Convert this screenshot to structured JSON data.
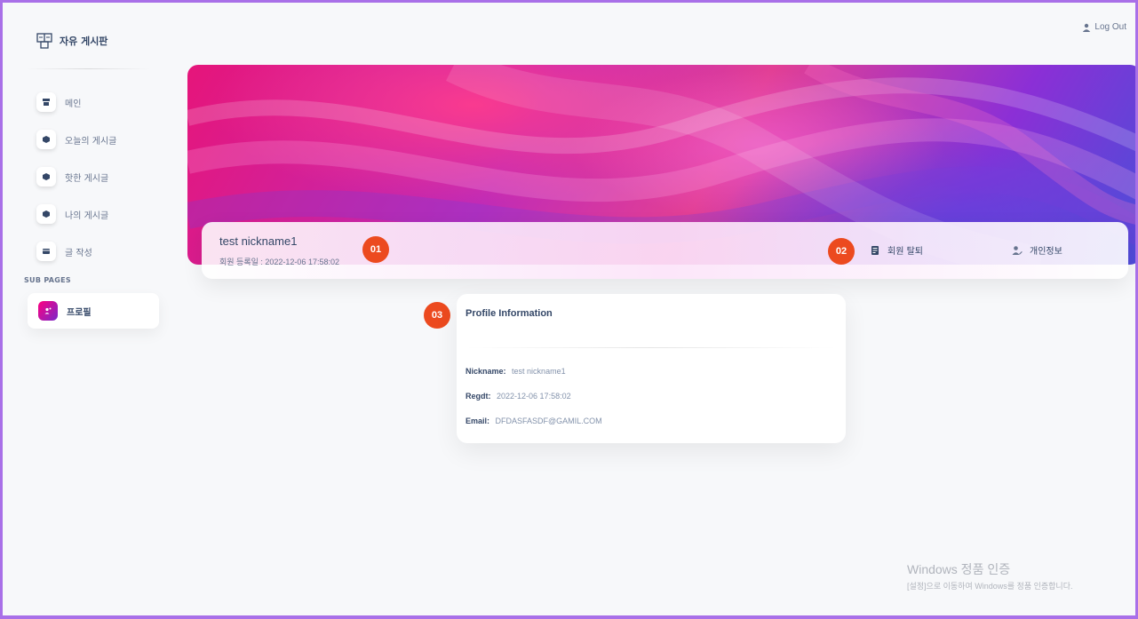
{
  "brand": {
    "title": "자유 게시판",
    "icon": "board-logo-icon"
  },
  "sidebar": {
    "items": [
      {
        "label": "메인",
        "icon": "store-icon"
      },
      {
        "label": "오늘의 게시글",
        "icon": "box-icon"
      },
      {
        "label": "핫한 게시글",
        "icon": "box-icon"
      },
      {
        "label": "나의 게시글",
        "icon": "box-icon"
      },
      {
        "label": "글 작성",
        "icon": "card-icon"
      }
    ],
    "section_label": "SUB PAGES",
    "active_item": {
      "label": "프로필",
      "icon": "user-icon"
    }
  },
  "header": {
    "logout_label": "Log Out"
  },
  "profile": {
    "name": "test nickname1",
    "regdate": "회원 등록일 : 2022-12-06 17:58:02",
    "actions": [
      {
        "label": "회원 탈퇴",
        "icon": "document-icon"
      },
      {
        "label": "개인정보",
        "icon": "user-edit-icon"
      }
    ]
  },
  "badges": [
    "01",
    "02",
    "03"
  ],
  "info": {
    "title": "Profile Information",
    "rows": [
      {
        "key": "Nickname:",
        "value": "test nickname1"
      },
      {
        "key": "Regdt:",
        "value": "2022-12-06 17:58:02"
      },
      {
        "key": "Email:",
        "value": "DFDASFASDF@GAMIL.COM"
      }
    ]
  },
  "watermark": {
    "line1": "Windows 정품 인증",
    "line2": "[설정]으로 이동하여 Windows를 정품 인증합니다."
  },
  "colors": {
    "accent": "#ec4a1f",
    "border": "#a970e8",
    "active_gradient_start": "#7928ca",
    "active_gradient_end": "#ff0080"
  }
}
